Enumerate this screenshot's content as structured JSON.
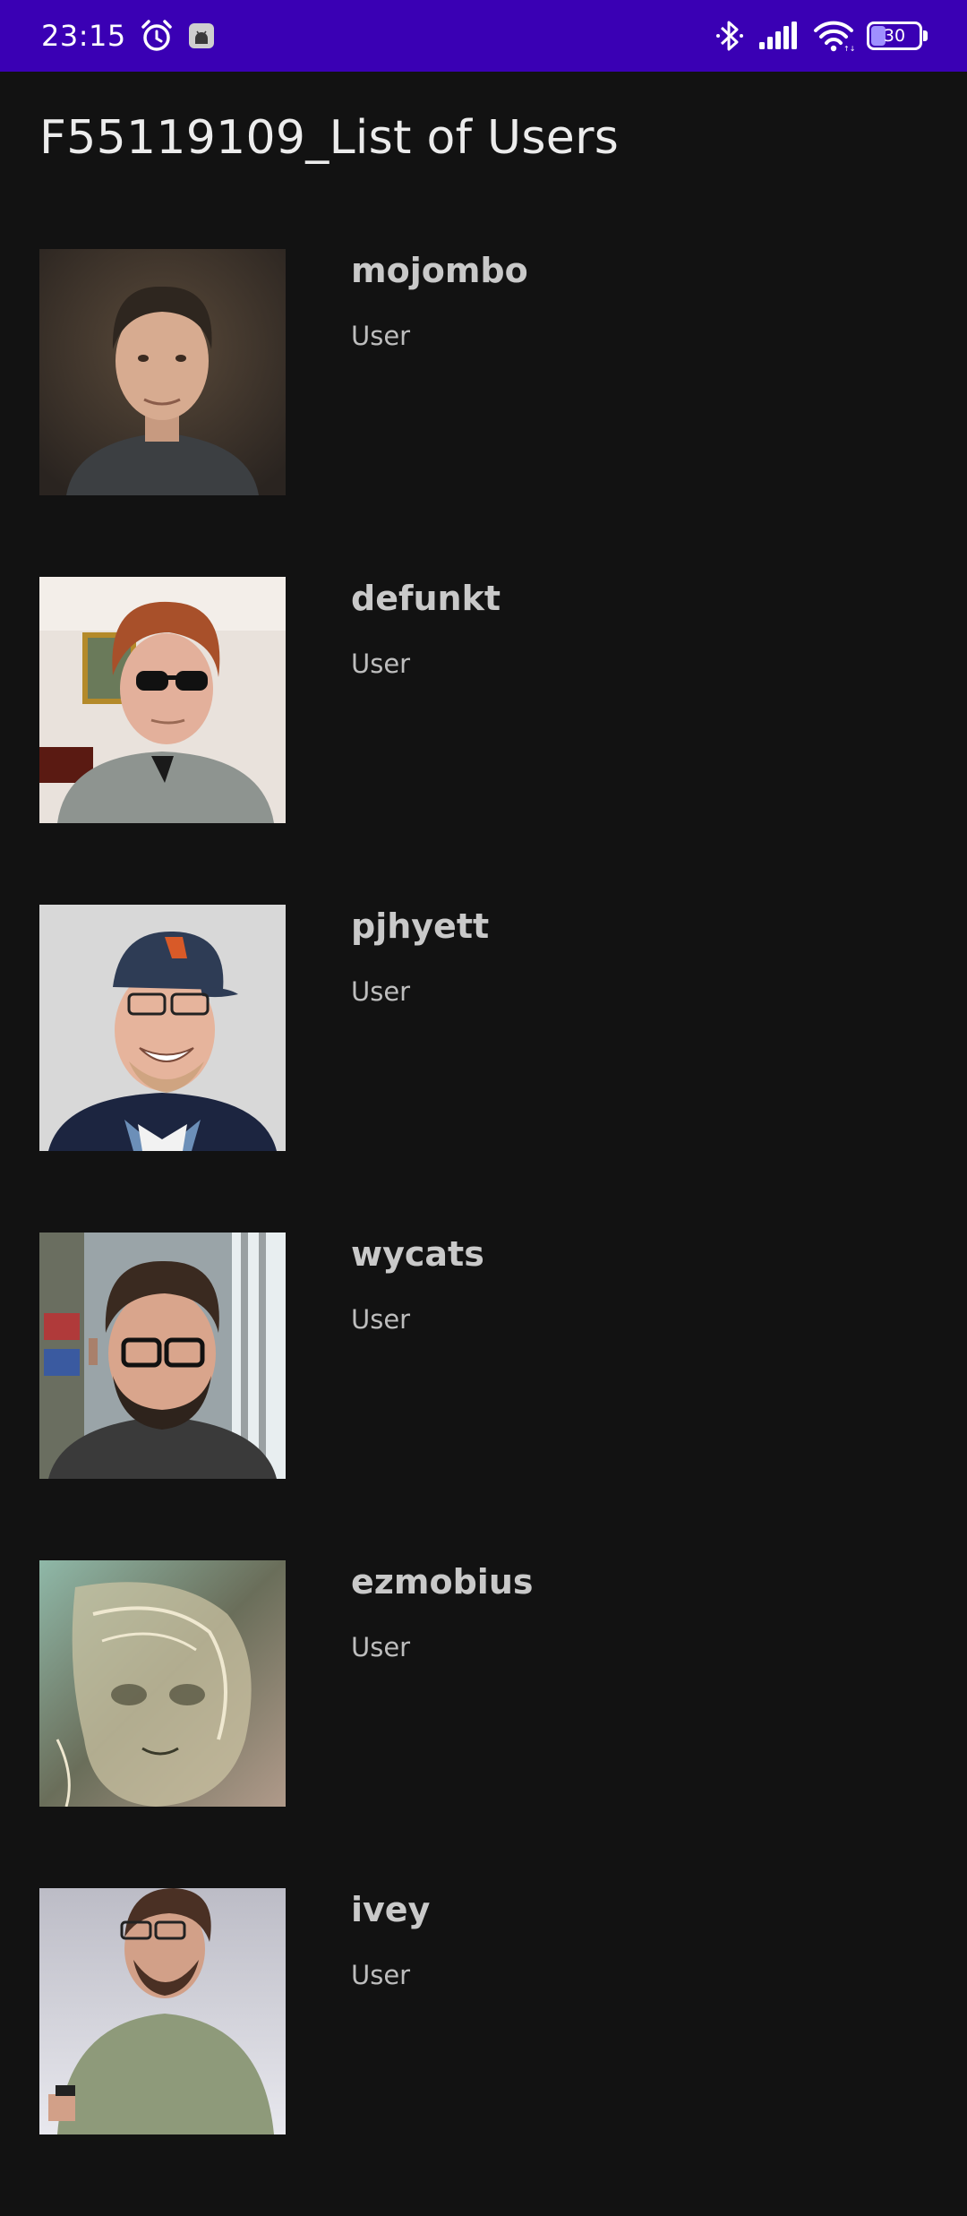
{
  "status_bar": {
    "time": "23:15",
    "battery_level": "30",
    "battery_fraction": 0.3,
    "icons": [
      "alarm-icon",
      "android-notification-icon",
      "bluetooth-icon",
      "cellular-signal-icon",
      "wifi-icon",
      "battery-icon"
    ],
    "background_color": "#3a00b4"
  },
  "page": {
    "title": "F55119109_List of Users",
    "background_color": "#121212"
  },
  "users": [
    {
      "login": "mojombo",
      "type": "User"
    },
    {
      "login": "defunkt",
      "type": "User"
    },
    {
      "login": "pjhyett",
      "type": "User"
    },
    {
      "login": "wycats",
      "type": "User"
    },
    {
      "login": "ezmobius",
      "type": "User"
    },
    {
      "login": "ivey",
      "type": "User"
    }
  ]
}
